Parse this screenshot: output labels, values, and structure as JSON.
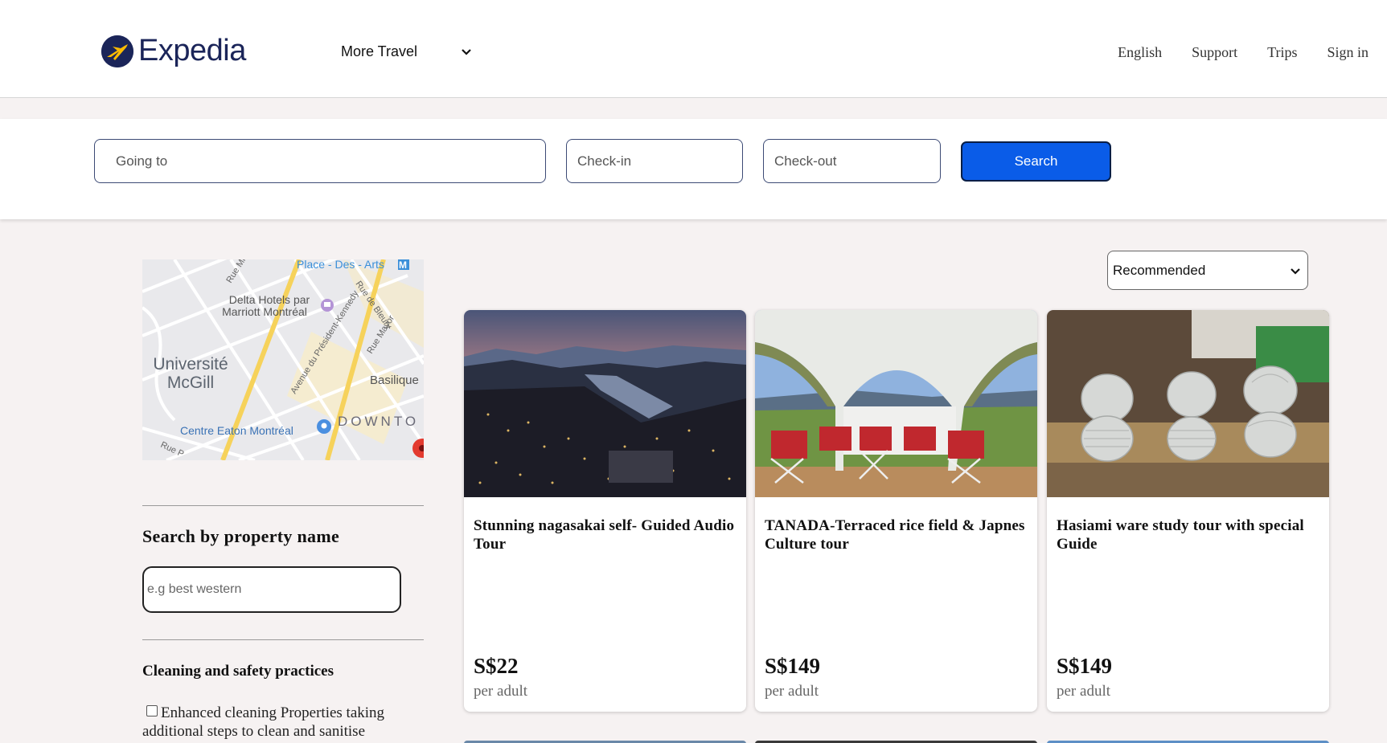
{
  "header": {
    "logo_text": "Expedia",
    "more_travel": "More Travel",
    "nav": [
      "English",
      "Support",
      "Trips",
      "Sign in"
    ]
  },
  "search": {
    "going_to": "Going to",
    "check_in": "Check-in",
    "check_out": "Check-out",
    "button": "Search"
  },
  "map": {
    "labels": [
      "Place - Des - Arts",
      "Delta Hotels par",
      "Marriott Montréal",
      "Université",
      "McGill",
      "Basilique",
      "DOWNTO",
      "Centre Eaton Montréal",
      "Rue de Bleury",
      "Avenue du Président-Kennedy",
      "Rue Mayor",
      "Rue Mi",
      "Rue P"
    ]
  },
  "sidebar": {
    "property_title": "Search by property name",
    "property_placeholder": "e.g best western",
    "cleaning_title": "Cleaning and safety practices",
    "cleaning_option": "Enhanced cleaning Properties taking additional steps to clean and sanitise"
  },
  "sort": {
    "selected": "Recommended"
  },
  "cards": [
    {
      "title": "Stunning nagasakai self- Guided Audio Tour",
      "price": "S$22",
      "unit": "per adult"
    },
    {
      "title": "TANADA-Terraced rice field & Japnes Culture tour",
      "price": "S$149",
      "unit": "per adult"
    },
    {
      "title": "Hasiami ware study tour with special Guide",
      "price": "S$149",
      "unit": "per adult"
    }
  ],
  "colors": {
    "brand_navy": "#1b2559",
    "logo_accent": "#fdbb02",
    "search_button": "#0a5ce8",
    "page_background": "#f6f2f2"
  }
}
